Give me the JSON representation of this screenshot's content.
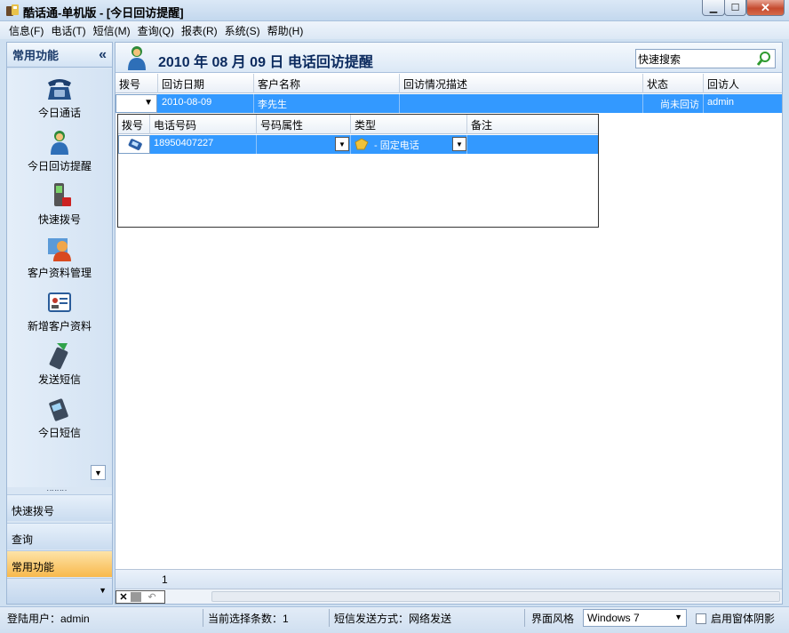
{
  "window": {
    "title": "酷话通-单机版 - [今日回访提醒]"
  },
  "menu": [
    "信息(F)",
    "电话(T)",
    "短信(M)",
    "查询(Q)",
    "报表(R)",
    "系统(S)",
    "帮助(H)"
  ],
  "sidebar": {
    "header": "常用功能",
    "collapse": "«",
    "items": [
      "今日通话",
      "今日回访提醒",
      "快速拨号",
      "客户资料管理",
      "新增客户资料",
      "发送短信",
      "今日短信"
    ],
    "grip": "‥‥‥‥",
    "bars": [
      "快速拨号",
      "查询",
      "常用功能"
    ]
  },
  "content": {
    "date_title": "2010 年 08 月 09 日 电话回访提醒",
    "search_value": "快速搜索",
    "columns": [
      "拨号",
      "回访日期",
      "客户名称",
      "回访情况描述",
      "状态",
      "回访人"
    ],
    "row": {
      "date": "2010-08-09",
      "customer": "李先生",
      "description": "",
      "status": "尚未回访",
      "visitor": "admin"
    },
    "detail": {
      "columns": [
        "拨号",
        "电话号码",
        "号码属性",
        "类型",
        "备注"
      ],
      "row": {
        "phone": "18950407227",
        "attribute": "",
        "type": "- 固定电话",
        "note": ""
      }
    },
    "footer_count": "1"
  },
  "status": {
    "login": "登陆用户：admin",
    "selected": "当前选择条数：1",
    "sms_mode": "短信发送方式：网络发送",
    "theme_label": "界面风格",
    "theme_value": "Windows 7",
    "shadow_label": "启用窗体阴影"
  },
  "colors": {
    "selection": "#3399ff",
    "accent": "#f8b94c"
  }
}
